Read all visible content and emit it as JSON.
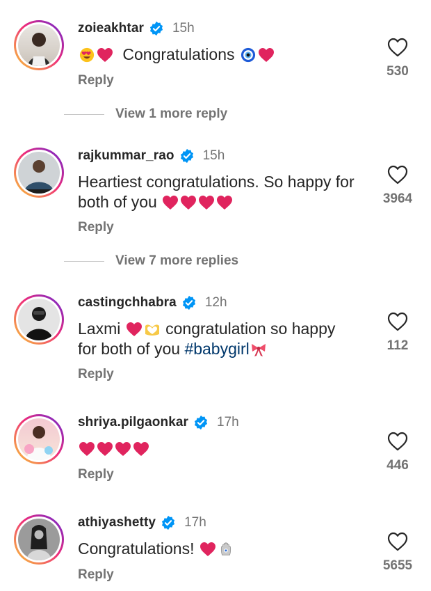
{
  "comments": [
    {
      "username": "zoieakhtar",
      "time": "15h",
      "text": "Congratulations",
      "likes": "530",
      "reply": "Reply",
      "view_more": "View 1 more reply"
    },
    {
      "username": "rajkummar_rao",
      "time": "15h",
      "text": "Heartiest congratulations. So happy for both of you",
      "likes": "3964",
      "reply": "Reply",
      "view_more": "View 7 more replies"
    },
    {
      "username": "castingchhabra",
      "time": "12h",
      "text_a": "Laxmi",
      "text_b": "congratulation so happy for both of you",
      "hashtag": "#babygirl",
      "likes": "112",
      "reply": "Reply"
    },
    {
      "username": "shriya.pilgaonkar",
      "time": "17h",
      "likes": "446",
      "reply": "Reply"
    },
    {
      "username": "athiyashetty",
      "time": "17h",
      "text": "Congratulations!",
      "likes": "5655",
      "reply": "Reply"
    }
  ],
  "icons": {
    "verified": "verified-badge-icon",
    "like": "heart-outline-icon",
    "heart_emoji": "red-heart-emoji",
    "heart_eyes": "heart-eyes-emoji",
    "evil_eye": "nazar-amulet-emoji",
    "heart_hands": "heart-hands-emoji",
    "bow": "ribbon-emoji",
    "hamsa": "hamsa-emoji"
  },
  "colors": {
    "verified": "#0095f6",
    "text": "#262626",
    "secondary": "#737373",
    "hashtag": "#00376b",
    "heart": "#e0245e"
  }
}
